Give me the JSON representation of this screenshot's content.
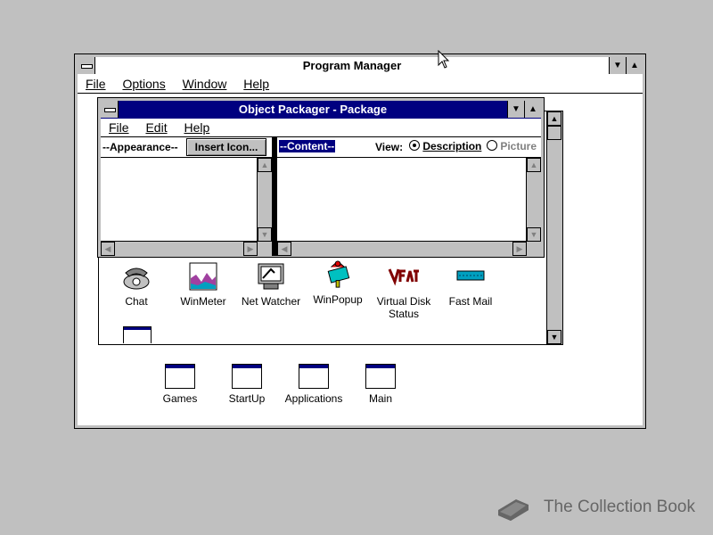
{
  "program_manager": {
    "title": "Program Manager",
    "menu": [
      "File",
      "Options",
      "Window",
      "Help"
    ]
  },
  "packager": {
    "title": "Object Packager - Package",
    "menu": [
      "File",
      "Edit",
      "Help"
    ],
    "appearance_label": "--Appearance--",
    "insert_icon_label": "Insert Icon...",
    "content_label": "--Content--",
    "view_label": "View:",
    "description_label": "Description",
    "picture_label": "Picture",
    "view_selected": "Description"
  },
  "group_items": [
    {
      "label": "Chat",
      "icon": "telephone-icon"
    },
    {
      "label": "WinMeter",
      "icon": "meter-icon"
    },
    {
      "label": "Net Watcher",
      "icon": "net-watcher-icon"
    },
    {
      "label": "WinPopup",
      "icon": "winpopup-icon"
    },
    {
      "label": "Virtual Disk Status",
      "icon": "vfat-icon"
    },
    {
      "label": "Fast Mail",
      "icon": "fastmail-icon"
    }
  ],
  "group_icons": [
    {
      "label": "Games"
    },
    {
      "label": "StartUp"
    },
    {
      "label": "Applications"
    },
    {
      "label": "Main"
    }
  ],
  "watermark": "The Collection Book",
  "colors": {
    "desktop": "#c0c0c0",
    "active_title": "#000080",
    "window_bg": "#ffffff"
  }
}
